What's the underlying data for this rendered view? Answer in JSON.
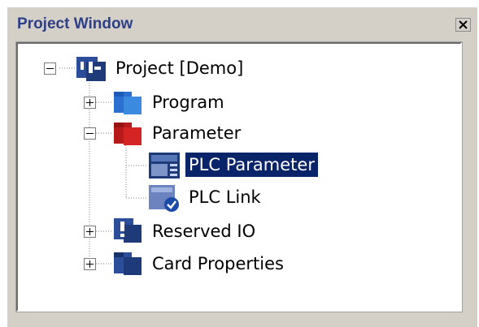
{
  "window": {
    "title": "Project Window",
    "close_icon": "close-icon"
  },
  "tree": {
    "root": {
      "label": "Project [Demo]",
      "icon": "project-icon",
      "expanded": true
    },
    "program": {
      "label": "Program",
      "icon": "program-folder-icon",
      "expanded": false
    },
    "parameter": {
      "label": "Parameter",
      "icon": "parameter-folder-icon",
      "expanded": true
    },
    "plc_parameter": {
      "label": "PLC Parameter",
      "icon": "plc-parameter-icon",
      "selected": true
    },
    "plc_link": {
      "label": "PLC Link",
      "icon": "plc-link-icon"
    },
    "reserved_io": {
      "label": "Reserved IO",
      "icon": "reserved-io-icon",
      "expanded": false
    },
    "card_properties": {
      "label": "Card Properties",
      "icon": "card-properties-icon",
      "expanded": false
    }
  },
  "colors": {
    "title_text": "#2d3f87",
    "selection": "#0a246a",
    "program_icon": "#3a7fd5",
    "parameter_icon": "#c81e1e",
    "dark_icon": "#1e3a78"
  }
}
